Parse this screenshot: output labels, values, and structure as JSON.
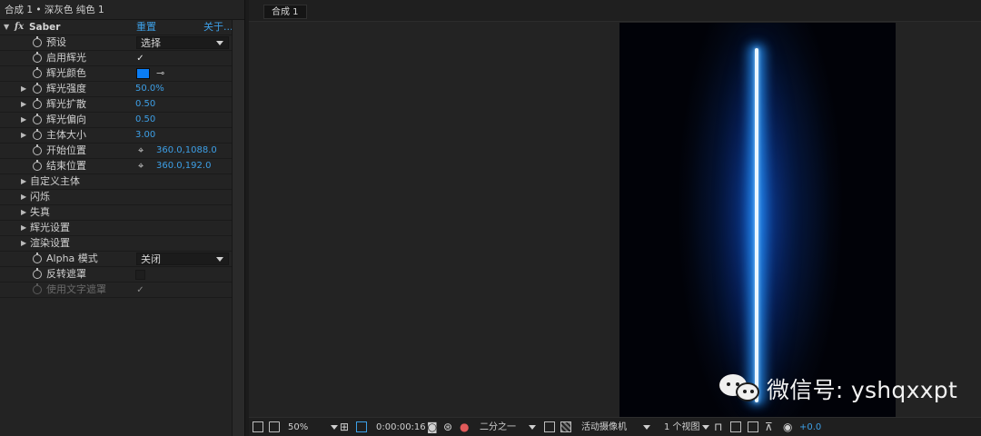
{
  "effect_panel": {
    "header": "合成 1 • 深灰色 纯色 1",
    "effect_name": "Saber",
    "reset": "重置",
    "about": "关于...",
    "props": {
      "preset": {
        "label": "预设",
        "value": "选择"
      },
      "enable_glow": {
        "label": "启用辉光",
        "checked": true
      },
      "glow_color": {
        "label": "辉光颜色",
        "color": "#0a7df5"
      },
      "glow_intensity": {
        "label": "辉光强度",
        "value": "50.0%"
      },
      "glow_spread": {
        "label": "辉光扩散",
        "value": "0.50"
      },
      "glow_bias": {
        "label": "辉光偏向",
        "value": "0.50"
      },
      "core_size": {
        "label": "主体大小",
        "value": "3.00"
      },
      "start_pos": {
        "label": "开始位置",
        "value": "360.0,1088.0"
      },
      "end_pos": {
        "label": "结束位置",
        "value": "360.0,192.0"
      },
      "custom_core": {
        "label": "自定义主体"
      },
      "flicker": {
        "label": "闪烁"
      },
      "distortion": {
        "label": "失真"
      },
      "glow_settings": {
        "label": "辉光设置"
      },
      "render_settings": {
        "label": "渲染设置"
      },
      "alpha_mode": {
        "label": "Alpha 模式",
        "value": "关闭"
      },
      "invert_mask": {
        "label": "反转遮罩",
        "checked": false
      },
      "use_text_mask": {
        "label": "使用文字遮罩",
        "checked": true
      }
    }
  },
  "viewer": {
    "tab": "合成 1",
    "watermark": "微信号: yshqxxpt",
    "toolbar": {
      "zoom": "50%",
      "timecode": "0:00:00:16",
      "resolution": "二分之一",
      "camera": "活动摄像机",
      "views": "1 个视图",
      "exposure": "+0.0"
    }
  },
  "colors": {
    "accent_blue_text": "#3d9fe6",
    "blade_core": "#eaf6ff",
    "glow": "#2d9bff"
  }
}
